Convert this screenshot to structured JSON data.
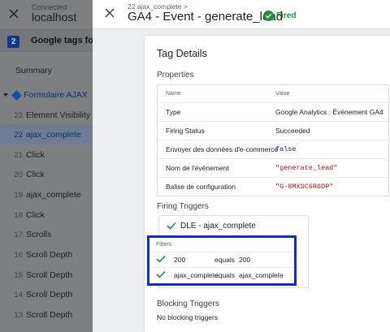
{
  "left": {
    "connected_label": "Connected",
    "host": "localhost",
    "tags_badge": "2",
    "tags_label": "Google tags found",
    "summary": "Summary",
    "folder": "Formulaire AJAX",
    "items": [
      {
        "num": "23",
        "label": "Element Visibility"
      },
      {
        "num": "22",
        "label": "ajax_complete"
      },
      {
        "num": "21",
        "label": "Click"
      },
      {
        "num": "20",
        "label": "Click"
      },
      {
        "num": "19",
        "label": "ajax_complete"
      },
      {
        "num": "18",
        "label": "Click"
      },
      {
        "num": "17",
        "label": "Scrolls"
      },
      {
        "num": "16",
        "label": "Scroll Depth"
      },
      {
        "num": "15",
        "label": "Scroll Depth"
      },
      {
        "num": "14",
        "label": "Scroll Depth"
      },
      {
        "num": "13",
        "label": "Scroll Depth"
      }
    ]
  },
  "header": {
    "breadcrumb": "22 ajax_complete >",
    "title": "GA4 - Event - generate_lead",
    "status": "Fired",
    "status_color": "#1e8e3e"
  },
  "card": {
    "title": "Tag Details",
    "properties_title": "Properties",
    "columns": {
      "name": "Name",
      "value": "Value"
    },
    "rows": [
      {
        "name": "Type",
        "value": "Google Analytics : Événement GA4"
      },
      {
        "name": "Firing Status",
        "value": "Succeeded"
      },
      {
        "name": "Envoyer des données d'e-commerce",
        "value": "false"
      },
      {
        "name": "Nom de l'événement",
        "value": "\"generate_lead\""
      },
      {
        "name": "Balise de configuration",
        "value": "\"G-8MXSC6R6DP\""
      }
    ],
    "firing_title": "Firing Triggers",
    "trigger_name": "DLE - ajax_complete",
    "filters_label": "Filters",
    "filters": [
      {
        "a": "200",
        "op": "equals",
        "b": "200"
      },
      {
        "a": "ajax_complete",
        "op": "equals",
        "b": "ajax_complete"
      }
    ],
    "blocking_title": "Blocking Triggers",
    "blocking_none": "No blocking triggers"
  },
  "colors": {
    "highlight_border": "#0b2fc7",
    "check_green": "#1e8e3e"
  }
}
